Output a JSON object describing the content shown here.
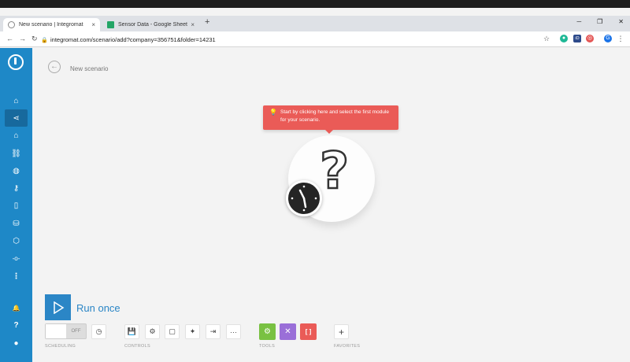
{
  "browser": {
    "tabs": [
      {
        "title": "New scenario | Integromat",
        "close": "×"
      },
      {
        "title": "Sensor Data - Google Sheets",
        "close": "×"
      }
    ],
    "new_tab": "+",
    "window_buttons": {
      "minimize": "─",
      "maximize": "❐",
      "close": "✕"
    },
    "nav": {
      "back": "←",
      "forward": "→",
      "reload": "↻"
    },
    "url": "integromat.com/scenario/add?company=356751&folder=14231",
    "profile_initial": "G",
    "menu": "⋮",
    "extensions": [
      {
        "label": "☆",
        "color": "#ffffff"
      },
      {
        "label": "●",
        "color": "#1eb896"
      },
      {
        "label": "iD",
        "color": "#2d4a8a"
      },
      {
        "label": "◎",
        "color": "#e45554"
      }
    ]
  },
  "sidebar": {
    "items": [
      {
        "icon": "home-icon",
        "glyph": "⌂"
      },
      {
        "icon": "share-icon",
        "glyph": "⋖",
        "active": true
      },
      {
        "icon": "team-icon",
        "glyph": "⌂"
      },
      {
        "icon": "link-icon",
        "glyph": "⛓"
      },
      {
        "icon": "globe-icon",
        "glyph": "◍"
      },
      {
        "icon": "key-icon",
        "glyph": "⚷"
      },
      {
        "icon": "device-icon",
        "glyph": "▯"
      },
      {
        "icon": "database-icon",
        "glyph": "⛁"
      },
      {
        "icon": "box-icon",
        "glyph": "⬡"
      },
      {
        "icon": "flow-icon",
        "glyph": "-o-"
      },
      {
        "icon": "more-icon",
        "glyph": "⋮"
      },
      {
        "icon": "bell-icon",
        "glyph": "🔔"
      },
      {
        "icon": "help-icon",
        "glyph": "?"
      },
      {
        "icon": "user-icon",
        "glyph": "●"
      }
    ]
  },
  "scenario": {
    "title": "New scenario",
    "back_glyph": "←",
    "tooltip": "Start by clicking here and select the first module for your scenario.",
    "tooltip_icon": "bulb-icon",
    "module_glyph": "?"
  },
  "controls": {
    "run_label": "Run once",
    "toggle_label": "OFF",
    "section_scheduling": "SCHEDULING",
    "section_controls": "CONTROLS",
    "section_tools": "TOOLS",
    "section_favorites": "FAVORITES",
    "schedule_glyph": "◷",
    "control_glyphs": [
      "💾",
      "⚙",
      "▢",
      "✦",
      "⇥",
      "···"
    ],
    "tools": [
      {
        "glyph": "⚙",
        "color": "#79c142"
      },
      {
        "glyph": "✕",
        "color": "#9a6fd8"
      },
      {
        "glyph": "[ ]",
        "color": "#ea5b57"
      }
    ],
    "favorites_add": "+"
  },
  "colors": {
    "sidebar": "#1e88c7",
    "accent": "#2b86c6",
    "tooltip": "#ea5b57"
  }
}
